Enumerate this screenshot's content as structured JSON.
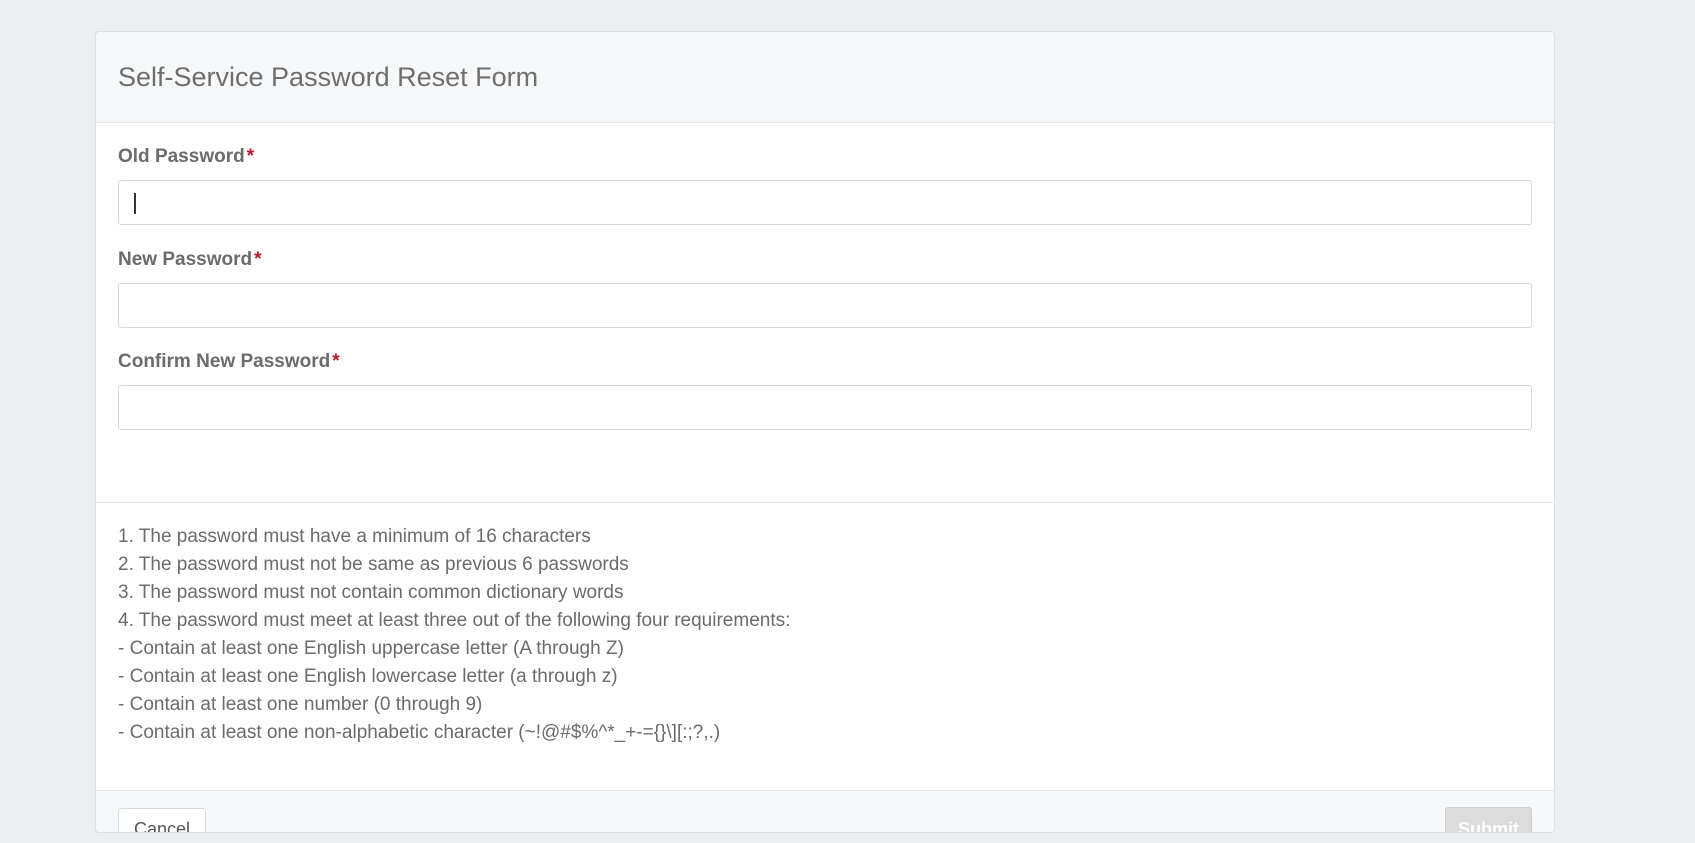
{
  "form": {
    "title": "Self-Service Password Reset Form",
    "required_marker": "*",
    "fields": [
      {
        "label": "Old Password",
        "value": "",
        "focused": true
      },
      {
        "label": "New Password",
        "value": ""
      },
      {
        "label": "Confirm New Password",
        "value": ""
      }
    ],
    "requirements": [
      "1. The password must have a minimum of 16 characters",
      "2. The password must not be same as previous 6 passwords",
      "3. The password must not contain common dictionary words",
      "4. The password must meet at least three out of the following four requirements:",
      "- Contain at least one English uppercase letter (A through Z)",
      "- Contain at least one English lowercase letter (a through z)",
      "- Contain at least one number (0 through 9)",
      "- Contain at least one non-alphabetic character (~!@#$%^*_+-={}\\][:;?,.)"
    ],
    "cancel_label": "Cancel",
    "submit_label": "Submit",
    "submit_disabled": true
  }
}
